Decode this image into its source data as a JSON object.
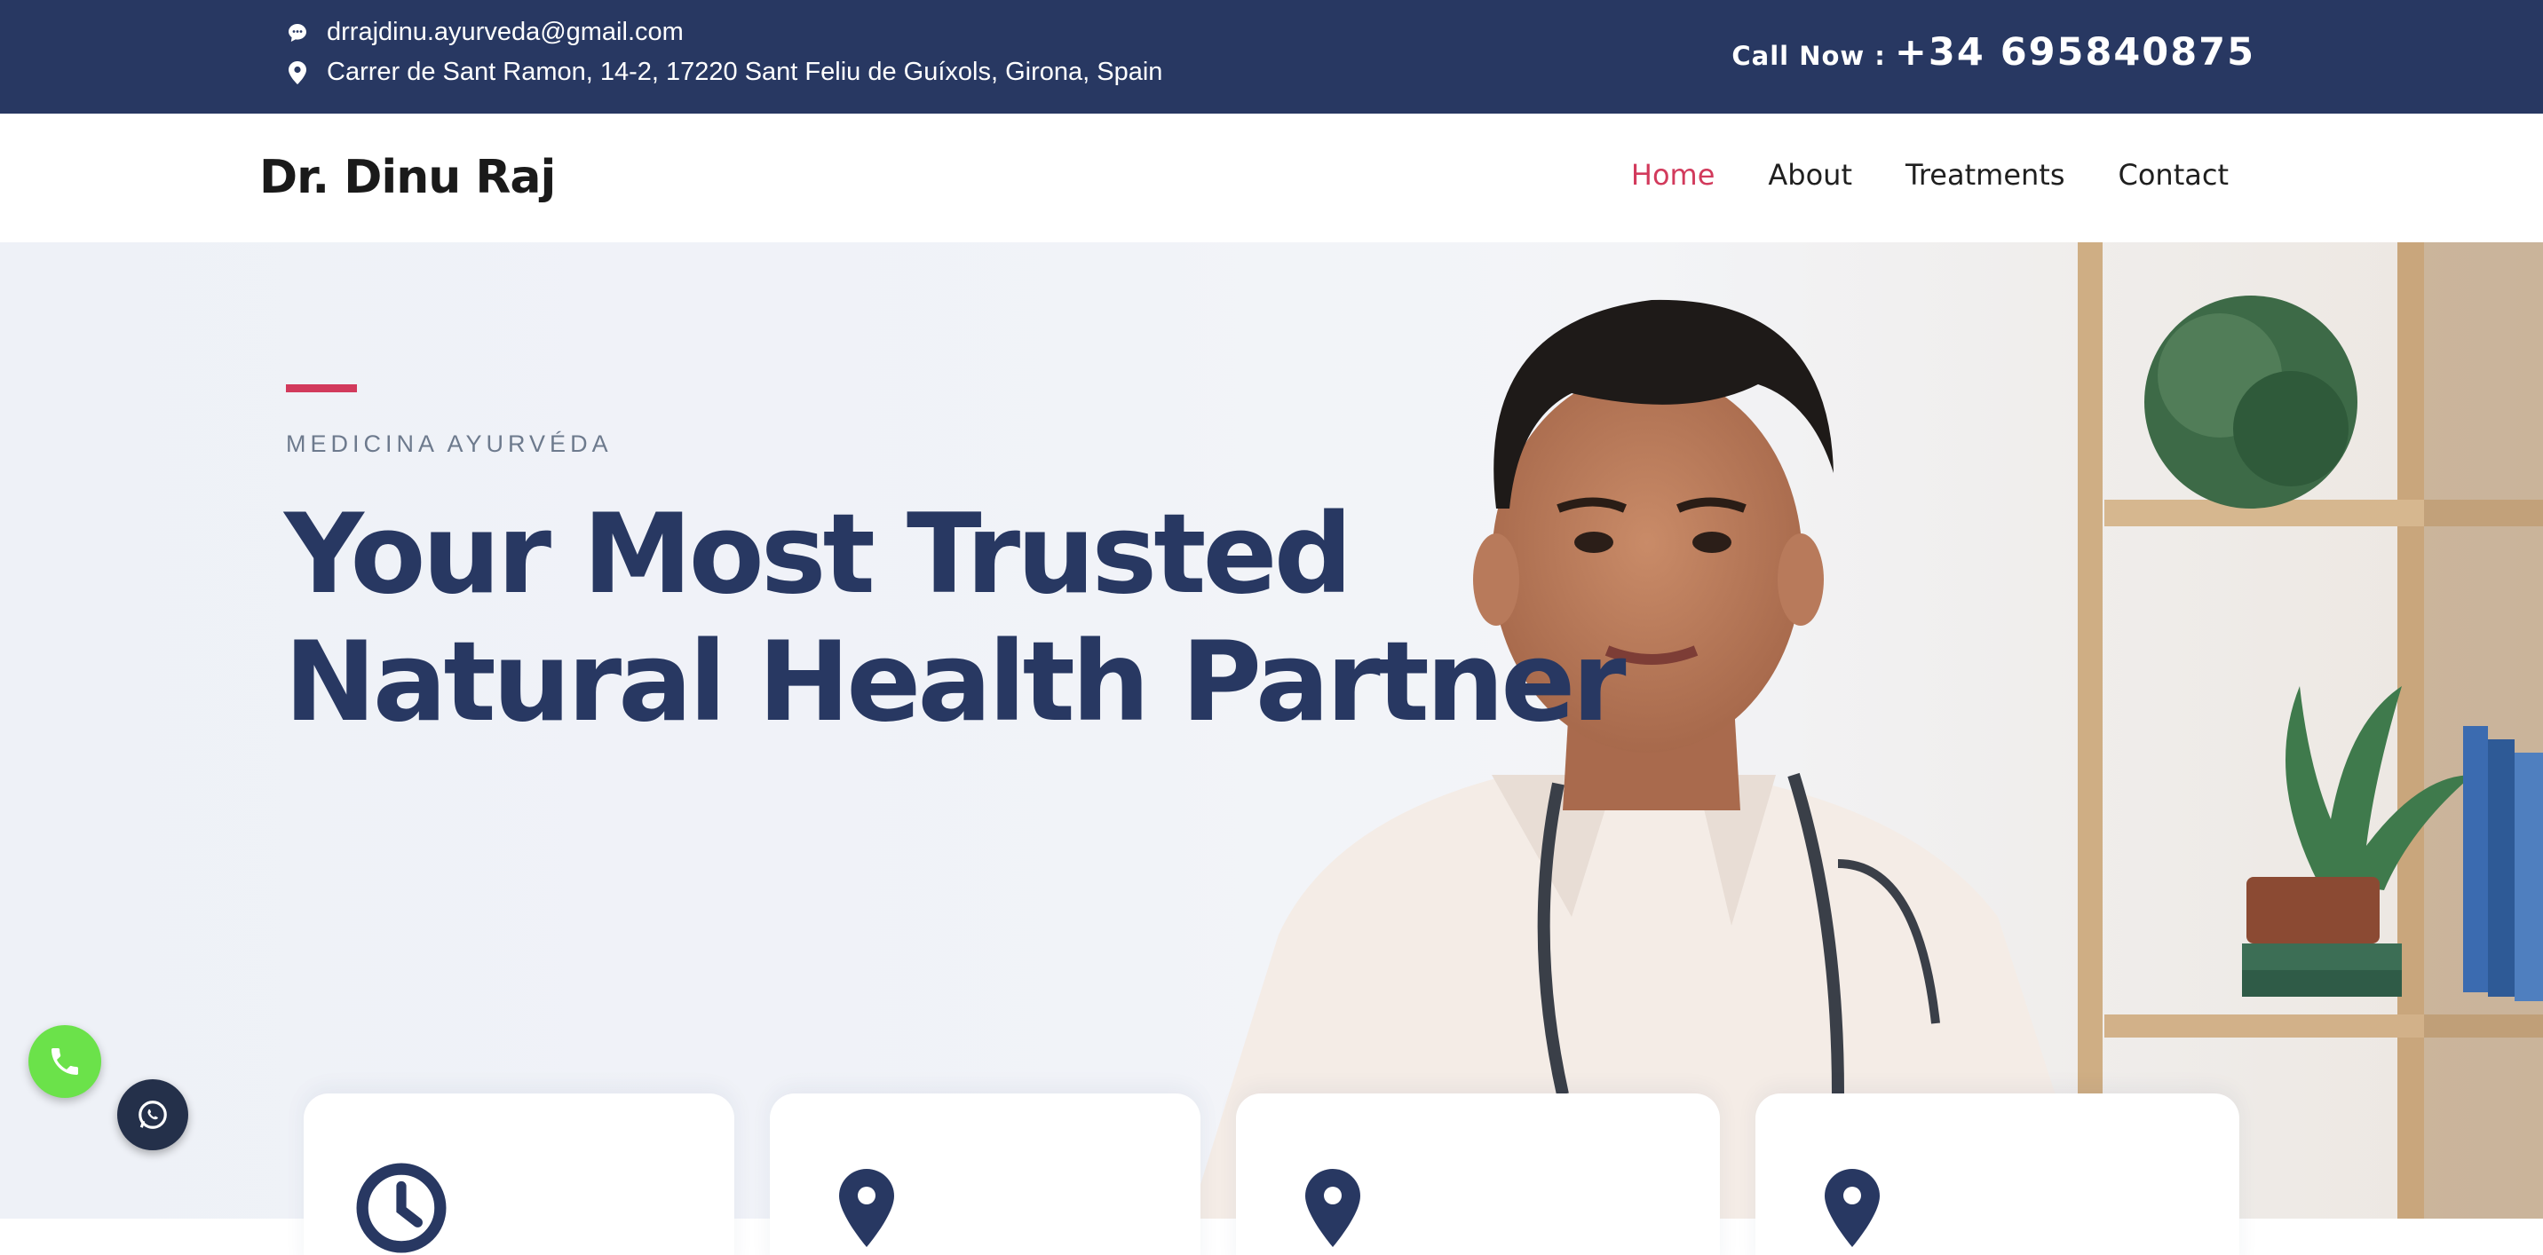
{
  "topbar": {
    "email": "drrajdinu.ayurveda@gmail.com",
    "address": "Carrer de Sant Ramon, 14-2, 17220 Sant Feliu de Guíxols, Girona, Spain",
    "call_label": "Call Now :",
    "phone": "+34 695840875",
    "background_color": "#283862"
  },
  "header": {
    "brand": "Dr. Dinu Raj",
    "nav": [
      {
        "label": "Home",
        "active": true
      },
      {
        "label": "About",
        "active": false
      },
      {
        "label": "Treatments",
        "active": false
      },
      {
        "label": "Contact",
        "active": false
      }
    ],
    "active_color": "#d23a5c"
  },
  "hero": {
    "eyebrow": "MEDICINA AYURVÉDA",
    "title_line1": "Your Most Trusted",
    "title_line2": "Natural Health Partner",
    "title_color": "#283862",
    "accent_color": "#d23a5c"
  },
  "floating": {
    "phone_icon": "phone-icon",
    "whatsapp_icon": "whatsapp-icon",
    "phone_color": "#6be24a",
    "whatsapp_color": "#24304a"
  },
  "cards": [
    {
      "icon": "clock-icon"
    },
    {
      "icon": "map-pin-icon"
    },
    {
      "icon": "map-pin-icon"
    },
    {
      "icon": "map-pin-icon"
    }
  ]
}
